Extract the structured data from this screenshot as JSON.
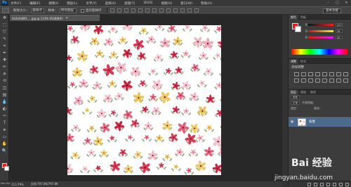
{
  "app": {
    "logo": "Ps"
  },
  "menu": [
    "文件(F)",
    "编辑(E)",
    "图像(I)",
    "图层(L)",
    "文字(Y)",
    "选择(S)",
    "滤镜(T)",
    "3D(D)",
    "视图(V)",
    "窗口(W)",
    "帮助(H)"
  ],
  "window_controls": {
    "minimize": "–",
    "maximize": "□",
    "close": "✕"
  },
  "options": {
    "sample_size_label": "取样大小：",
    "sample_size_value": "取样点",
    "sample_label": "样本：",
    "sample_value": "所有图层",
    "show_ring_label": "显示取样环",
    "workspace": "基本功能"
  },
  "document": {
    "tab_title": "0e2e5d8f1... .jpg @ 113% (RGB/8#)",
    "close": "✕",
    "zoom": "113.79%",
    "doc_info": "文档:797.8K/797.8K"
  },
  "status_stub": "Mini Bridge",
  "tools": [
    "move",
    "marquee",
    "lasso",
    "quick-select",
    "crop",
    "eyedropper",
    "healing",
    "brush",
    "clone",
    "history",
    "eraser",
    "gradient",
    "blur",
    "dodge",
    "pen",
    "type",
    "path-select",
    "shape",
    "hand",
    "zoom"
  ],
  "tool_glyphs": [
    "✥",
    "⬚",
    "➰",
    "✎",
    "⌗",
    "✒",
    "✚",
    "✏",
    "⎈",
    "⟲",
    "◫",
    "▤",
    "💧",
    "◐",
    "✑",
    "T",
    "➤",
    "▭",
    "✋",
    "🔍"
  ],
  "color_panel": {
    "tabs": [
      "颜色",
      "色板"
    ],
    "r_label": "R",
    "r_value": "227",
    "g_label": "G",
    "g_value": "26",
    "b_label": "B",
    "b_value": "26",
    "fg": "#e31a1a",
    "bg": "#ffffff"
  },
  "adjust_panel": {
    "tabs": [
      "调整",
      "样式"
    ],
    "heading": "添加调整"
  },
  "layers_panel": {
    "tabs": [
      "图层",
      "通道",
      "路径"
    ],
    "kind_label": "类型",
    "blend_mode": "正常",
    "opacity_label": "不透明度：",
    "lock_label": "锁定：",
    "fill_label": "填充：",
    "layer_name": "背景"
  },
  "watermark": {
    "line1": "Bai 经验",
    "line2": "jingyan.baidu.com"
  }
}
